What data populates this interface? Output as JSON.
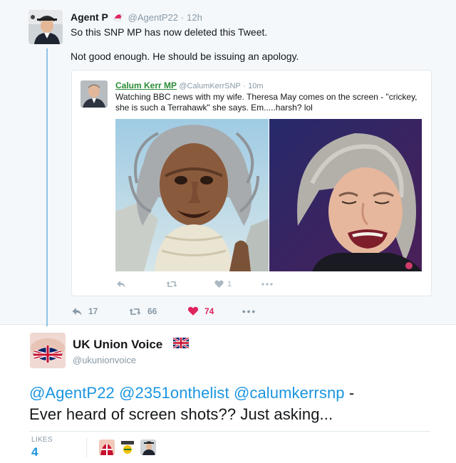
{
  "tweet": {
    "author_name": "Agent P",
    "author_handle": "@AgentP22",
    "separator": "·",
    "time": "12h",
    "text_line1": "So this SNP MP has now deleted this Tweet.",
    "text_line2": "Not good enough. He should be issuing an apology.",
    "actions": {
      "replies": "17",
      "retweets": "66",
      "likes": "74"
    }
  },
  "quoted": {
    "author_name": "Calum Kerr MP",
    "author_handle": "@CalumKerrSNP",
    "separator": "·",
    "time": "10m",
    "text_line1": "Watching BBC news with my wife. Theresa May comes on the screen - \"crickey,",
    "text_line2": "she is such a Terrahawk\" she says. Em.....harsh? lol",
    "actions": {
      "likes": "1"
    }
  },
  "reply": {
    "author_name": "UK Union Voice",
    "author_handle": "@ukunionvoice",
    "mentions": [
      "@AgentP22",
      "@2351onthelist",
      "@calumkerrsnp"
    ],
    "text_tail": " -",
    "text_line2": "Ever heard of screen shots?? Just asking...",
    "likes_label": "LIKES",
    "likes_count": "4"
  },
  "colors": {
    "mention_blue": "#1b95e0",
    "like_red": "#e0245e",
    "thread_line": "#8ec2e6",
    "quoted_name_green": "#2a8c35"
  },
  "icons": [
    "reply-icon",
    "retweet-icon",
    "heart-icon",
    "more-icon",
    "santa-hat-icon",
    "uk-flag-icon"
  ]
}
